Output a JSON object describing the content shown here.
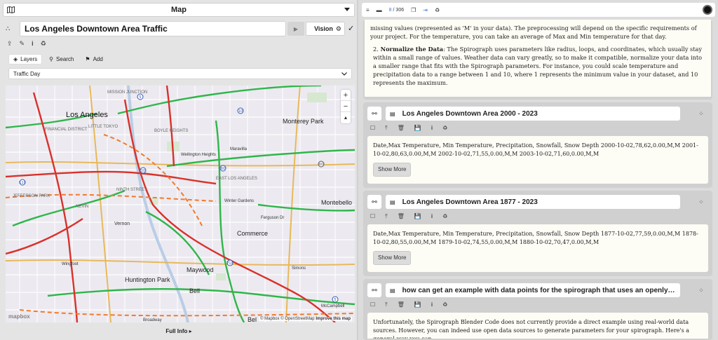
{
  "left": {
    "header_title": "Map",
    "map_title": "Los Angeles Downtown Area Traffic",
    "vision_label": "Vision",
    "tabs": [
      {
        "label": "Layers"
      },
      {
        "label": "Search"
      },
      {
        "label": "Add"
      }
    ],
    "layer_dropdown": "Traffic Day",
    "map_labels": {
      "los_angeles": "Los Angeles",
      "monterey_park": "Monterey Park",
      "montebello": "Montebello",
      "commerce": "Commerce",
      "huntington_park": "Huntington Park",
      "maywood": "Maywood",
      "bell": "Bell",
      "vernon": "Vernon",
      "bell_short": "Bel",
      "mission_junction": "MISSION JUNCTION",
      "financial_district": "FINANCIAL DISTRICT",
      "little_tokyo": "LITTLE TOKYO",
      "boyle_heights": "BOYLE HEIGHTS",
      "ninth_street": "NINTH STREET",
      "jefferson_park": "JEFFERSON PARK",
      "nevin": "NEVIN",
      "wingfoot": "Wingfoot",
      "maravilla": "Maravilla",
      "wellington_heights": "Wellington Heights",
      "east_la": "EAST LOS ANGELES",
      "winter_gardens": "Winter Gardens",
      "ferguson": "Ferguson Dr",
      "simons": "Simons",
      "mcc": "McCampbell",
      "broadway": "Broadway"
    },
    "attribution": {
      "mapbox": "© Mapbox",
      "osm": "© OpenStreetMap",
      "improve": "Improve this map"
    },
    "logo": "mapbox",
    "full_info": "Full Info"
  },
  "right": {
    "page_current": "8",
    "page_total": "/ 306",
    "top_text": {
      "line_intro": "missing values (represented as 'M' in your data). The preprocessing will depend on the specific requirements of your project. For the temperature, you can take an average of Max and Min temperature for that day.",
      "item_num": "2.",
      "item_bold": "Normalize the Data",
      "item_text": ": The Spirograph uses parameters like radius, loops, and coordinates, which usually stay within a small range of values. Weather data can vary greatly, so to make it compatible, normalize your data into a smaller range that fits with the Spirograph parameters. For instance, you could scale temperature and precipitation data to a range between 1 and 10, where 1 represents the minimum value in your dataset, and 10 represents the maximum."
    },
    "cards": [
      {
        "title": "Los Angeles Downtown Area 2000 - 2023",
        "body": "Date,Max Temperature, Min Temperature, Precipitation, Snowfall, Snow Depth 2000-10-02,78,62,0.00,M,M 2001-10-02,80,63,0.00,M,M 2002-10-02,71,55,0.00,M,M 2003-10-02,71,60,0.00,M,M",
        "show_more": "Show More"
      },
      {
        "title": "Los Angeles Downtown Area 1877 - 2023",
        "body": "Date,Max Temperature, Min Temperature, Precipitation, Snowfall, Snow Depth 1877-10-02,77,59,0.00,M,M 1878-10-02,80,55,0.00,M,M 1879-10-02,74,55,0.00,M,M 1880-10-02,70,47,0.00,M,M",
        "show_more": "Show More"
      },
      {
        "title": "how can get an example with data points for the spirograph that uses an openly availy dat...",
        "body": "Unfortunately, the Spirograph Blender Code does not currently provide a direct example using real-world data sources. However, you can indeed use open data sources to generate parameters for your spirograph. Here's a general way you can"
      }
    ]
  }
}
